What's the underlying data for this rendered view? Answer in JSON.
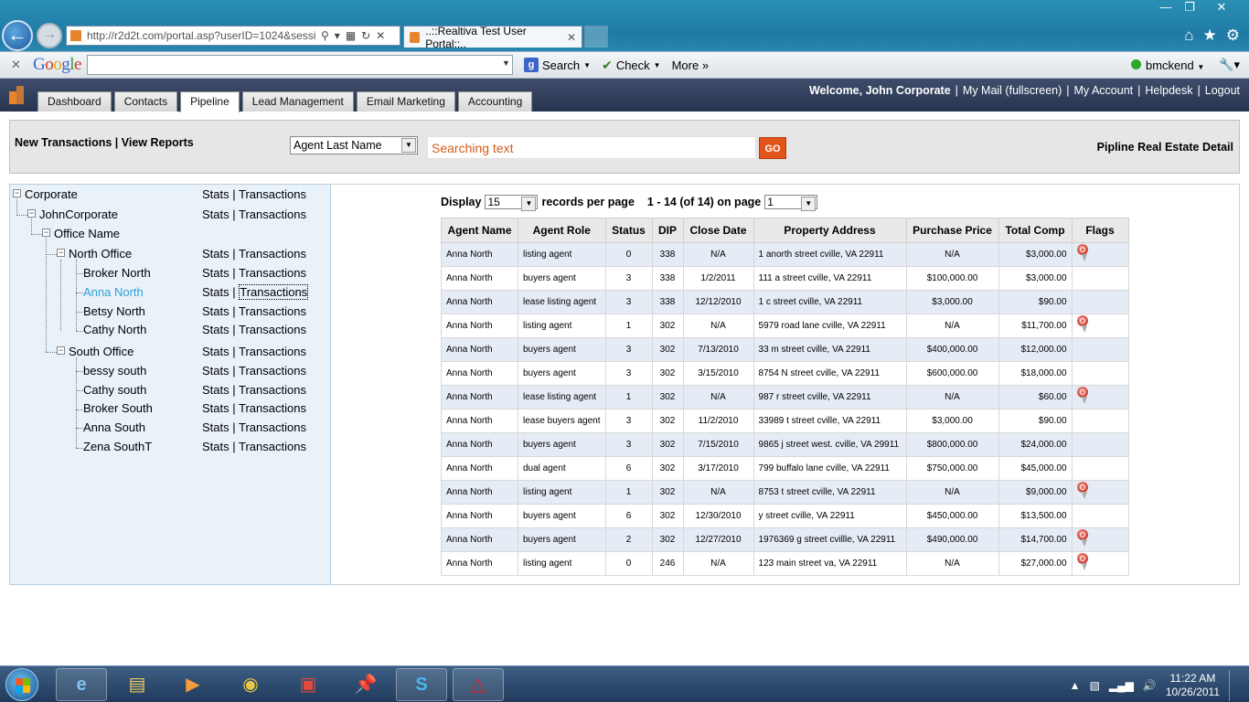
{
  "browser": {
    "url": "http://r2d2t.com/portal.asp?userID=1024&sessic",
    "tab_title": "..::Realtiva Test User Portal::..",
    "toolbar_search_label": "Search",
    "toolbar_check_label": "Check",
    "toolbar_more_label": "More »",
    "user": "bmckend"
  },
  "app_tabs": [
    "Dashboard",
    "Contacts",
    "Pipeline",
    "Lead Management",
    "Email Marketing",
    "Accounting"
  ],
  "header": {
    "welcome": "Welcome, John Corporate",
    "links": [
      "My Mail (fullscreen)",
      "My Account",
      "Helpdesk",
      "Logout"
    ]
  },
  "search": {
    "links": "New Transactions | View Reports",
    "field_select": "Agent Last Name",
    "placeholder": "Searching text",
    "go": "GO",
    "title": "Pipline Real Estate Detail"
  },
  "tree": {
    "stats": "Stats",
    "sep": " | ",
    "transactions": "Transactions",
    "nodes": [
      "Corporate",
      "JohnCorporate",
      "Office Name",
      "North Office",
      "Broker North",
      "Anna North",
      "Betsy North",
      "Cathy North",
      "South Office",
      "bessy south",
      "Cathy south",
      "Broker South",
      "Anna South",
      "Zena SouthT"
    ]
  },
  "pager": {
    "display_label": "Display",
    "per_page_value": "15",
    "records_label": "records per page",
    "range": "1 - 14 (of 14) on page",
    "page_value": "1"
  },
  "table": {
    "headers": [
      "Agent Name",
      "Agent Role",
      "Status",
      "DIP",
      "Close Date",
      "Property Address",
      "Purchase Price",
      "Total Comp",
      "Flags"
    ],
    "rows": [
      [
        "Anna North",
        "listing agent",
        "0",
        "338",
        "N/A",
        "1 anorth street cville, VA 22911",
        "N/A",
        "$3,000.00",
        true
      ],
      [
        "Anna North",
        "buyers agent",
        "3",
        "338",
        "1/2/2011",
        "111 a street cville, VA 22911",
        "$100,000.00",
        "$3,000.00",
        false
      ],
      [
        "Anna North",
        "lease listing agent",
        "3",
        "338",
        "12/12/2010",
        "1 c street cville, VA 22911",
        "$3,000.00",
        "$90.00",
        false
      ],
      [
        "Anna North",
        "listing agent",
        "1",
        "302",
        "N/A",
        "5979 road lane cville, VA 22911",
        "N/A",
        "$11,700.00",
        true
      ],
      [
        "Anna North",
        "buyers agent",
        "3",
        "302",
        "7/13/2010",
        "33 m street cville, VA 22911",
        "$400,000.00",
        "$12,000.00",
        false
      ],
      [
        "Anna North",
        "buyers agent",
        "3",
        "302",
        "3/15/2010",
        "8754 N street cville, VA 22911",
        "$600,000.00",
        "$18,000.00",
        false
      ],
      [
        "Anna North",
        "lease listing agent",
        "1",
        "302",
        "N/A",
        "987 r street cville, VA 22911",
        "N/A",
        "$60.00",
        true
      ],
      [
        "Anna North",
        "lease buyers agent",
        "3",
        "302",
        "11/2/2010",
        "33989 t street cville, VA 22911",
        "$3,000.00",
        "$90.00",
        false
      ],
      [
        "Anna North",
        "buyers agent",
        "3",
        "302",
        "7/15/2010",
        "9865 j street west. cville, VA 29911",
        "$800,000.00",
        "$24,000.00",
        false
      ],
      [
        "Anna North",
        "dual agent",
        "6",
        "302",
        "3/17/2010",
        "799 buffalo lane cville, VA 22911",
        "$750,000.00",
        "$45,000.00",
        false
      ],
      [
        "Anna North",
        "listing agent",
        "1",
        "302",
        "N/A",
        "8753 t street cville, VA 22911",
        "N/A",
        "$9,000.00",
        true
      ],
      [
        "Anna North",
        "buyers agent",
        "6",
        "302",
        "12/30/2010",
        "y street cville, VA 22911",
        "$450,000.00",
        "$13,500.00",
        false
      ],
      [
        "Anna North",
        "buyers agent",
        "2",
        "302",
        "12/27/2010",
        "1976369 g street cvillle, VA 22911",
        "$490,000.00",
        "$14,700.00",
        true
      ],
      [
        "Anna North",
        "listing agent",
        "0",
        "246",
        "N/A",
        "123 main street va, VA 22911",
        "N/A",
        "$27,000.00",
        true
      ]
    ]
  },
  "taskbar": {
    "time": "11:22 AM",
    "date": "10/26/2011"
  }
}
